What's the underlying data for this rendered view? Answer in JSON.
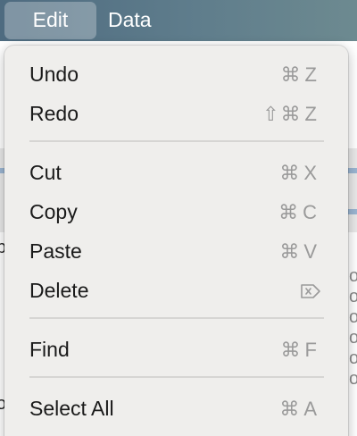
{
  "menubar": {
    "items": [
      {
        "label": "Edit",
        "active": true
      },
      {
        "label": "Data",
        "active": false
      }
    ]
  },
  "background": {
    "edge_glyphs": [
      "p",
      "o",
      "o",
      "o",
      "o",
      "o",
      "o",
      "o"
    ]
  },
  "edit_menu": {
    "items": [
      {
        "label": "Undo",
        "modifier": "⌘",
        "key": "Z"
      },
      {
        "label": "Redo",
        "modifier": "⇧⌘",
        "key": "Z"
      },
      {
        "label": "Cut",
        "modifier": "⌘",
        "key": "X"
      },
      {
        "label": "Copy",
        "modifier": "⌘",
        "key": "C"
      },
      {
        "label": "Paste",
        "modifier": "⌘",
        "key": "V"
      },
      {
        "label": "Delete",
        "shortcut_icon": "delete-forward-icon"
      },
      {
        "label": "Find",
        "modifier": "⌘",
        "key": "F"
      },
      {
        "label": "Select All",
        "modifier": "⌘",
        "key": "A"
      }
    ]
  },
  "colors": {
    "menubar": "#5a7788",
    "menu_background": "#efeeec",
    "shortcut_text": "#9a9a9a",
    "label_text": "#1a1a1a"
  }
}
